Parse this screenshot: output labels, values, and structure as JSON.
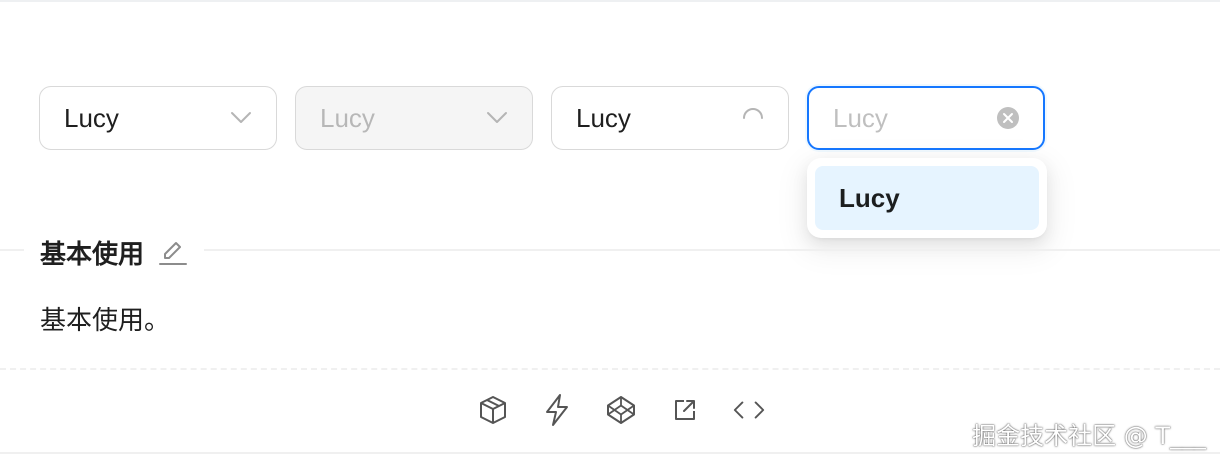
{
  "selects": [
    {
      "value": "Lucy",
      "state": "default",
      "suffix_icon": "chevron-down-icon"
    },
    {
      "value": "Lucy",
      "state": "disabled",
      "suffix_icon": "chevron-down-icon"
    },
    {
      "value": "Lucy",
      "state": "loading",
      "suffix_icon": "loading-spinner-icon"
    },
    {
      "placeholder": "Lucy",
      "state": "focused-open",
      "suffix_icon": "clear-circle-icon"
    }
  ],
  "dropdown": {
    "options": [
      {
        "label": "Lucy",
        "active": true
      }
    ]
  },
  "section": {
    "title": "基本使用",
    "description": "基本使用。",
    "edit_icon": "edit-pencil-icon"
  },
  "actions": [
    {
      "icon": "codesandbox-icon"
    },
    {
      "icon": "stackblitz-lightning-icon"
    },
    {
      "icon": "codepen-icon"
    },
    {
      "icon": "external-link-icon"
    },
    {
      "icon": "code-brackets-icon"
    }
  ],
  "watermark": "掘金技术社区 @ T___",
  "colors": {
    "accent": "#1677ff",
    "option_active_bg": "#e6f4ff",
    "border": "#d9d9d9",
    "disabled_bg": "#f5f5f5",
    "icon_gray": "#8c8c8c"
  }
}
